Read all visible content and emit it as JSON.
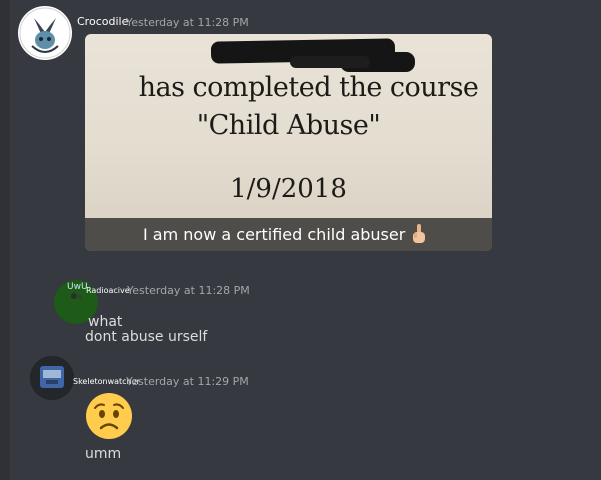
{
  "messages": [
    {
      "username": "Crocodile",
      "timestamp": "Yesterday at 11:28 PM",
      "attachment": {
        "certificate_line1": "has completed the course",
        "certificate_line2": "\"Child Abuse\"",
        "certificate_date": "1/9/2018",
        "caption": "I am now a certified child abuser",
        "caption_emoji": "hand-emoji"
      }
    },
    {
      "username": "Radioacive",
      "avatar_text": "UwU",
      "timestamp": "Yesterday at 11:28 PM",
      "lines": [
        "what",
        "dont abuse urself"
      ]
    },
    {
      "username": "Skeletonwatcher",
      "timestamp": "Yesterday at 11:29 PM",
      "emoji": "worried-face-emoji",
      "lines": [
        "umm"
      ]
    }
  ],
  "colors": {
    "background": "#36393f",
    "username": "#ffffff",
    "timestamp": "#a3a6aa",
    "text": "#dcddde"
  }
}
